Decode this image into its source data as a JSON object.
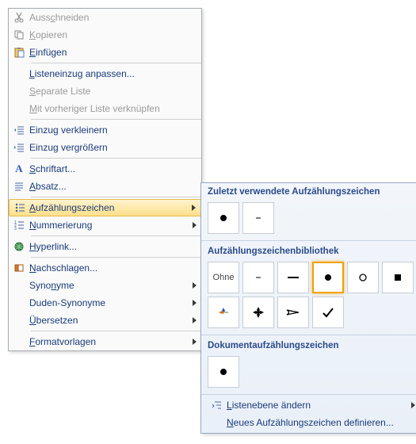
{
  "menu": {
    "cut": "Ausschneiden",
    "copy": "Kopieren",
    "paste": "Einfügen",
    "adjust_indent": "Listeneinzug anpassen...",
    "separate_list": "Separate Liste",
    "link_prev": "Mit vorheriger Liste verknüpfen",
    "decrease_indent": "Einzug verkleinern",
    "increase_indent": "Einzug vergrößern",
    "font": "Schriftart...",
    "paragraph": "Absatz...",
    "bullets": "Aufzählungszeichen",
    "numbering": "Nummerierung",
    "hyperlink": "Hyperlink...",
    "lookup": "Nachschlagen...",
    "synonyms": "Synonyme",
    "duden": "Duden-Synonyme",
    "translate": "Übersetzen",
    "styles": "Formatvorlagen"
  },
  "submenu": {
    "recent_header": "Zuletzt verwendete Aufzählungszeichen",
    "library_header": "Aufzählungszeichenbibliothek",
    "document_header": "Dokumentaufzählungszeichen",
    "none_label": "Ohne",
    "change_level": "Listenebene ändern",
    "define_new": "Neues Aufzählungszeichen definieren..."
  }
}
